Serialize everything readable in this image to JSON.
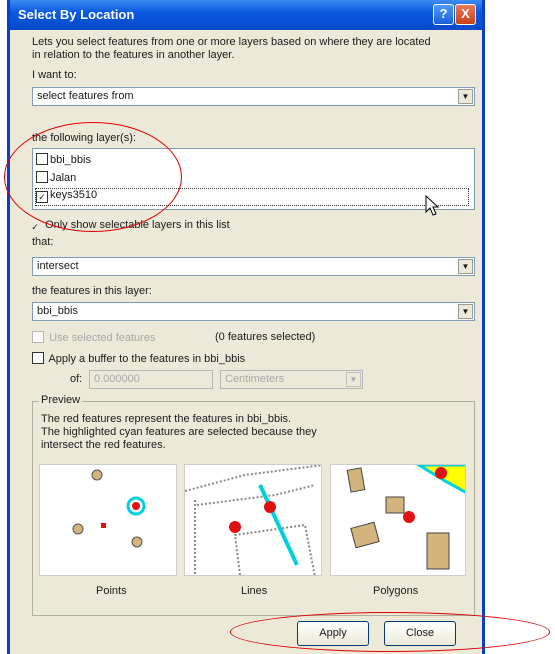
{
  "window": {
    "title": "Select By Location",
    "help_glyph": "?",
    "close_glyph": "X"
  },
  "description": {
    "line1": "Lets you select features from one or more layers based on where they are located",
    "line2": "in relation to the features in another layer."
  },
  "i_want_to": {
    "label": "I want to:",
    "value": "select features from"
  },
  "layers": {
    "label": "the following layer(s):",
    "items": [
      {
        "name": "bbi_bbis",
        "checked": false
      },
      {
        "name": "Jalan",
        "checked": false
      },
      {
        "name": "keys3510",
        "checked": true
      }
    ]
  },
  "only_selectable": {
    "label": "Only show selectable layers in this list",
    "checked": true
  },
  "that": {
    "label": "that:",
    "value": "intersect"
  },
  "features_layer": {
    "label": "the features in this layer:",
    "value": "bbi_bbis"
  },
  "use_selected": {
    "label": "Use selected features",
    "count_text": "(0 features selected)"
  },
  "buffer": {
    "label": "Apply a buffer to the features in  bbi_bbis",
    "of_label": "of:",
    "distance": "0.000000",
    "units": "Centimeters"
  },
  "preview": {
    "title": "Preview",
    "line1": "The red features represent the features in bbi_bbis.",
    "line2": "The highlighted cyan features are selected because they",
    "line3": "intersect the red features.",
    "captions": {
      "points": "Points",
      "lines": "Lines",
      "polygons": "Polygons"
    }
  },
  "buttons": {
    "apply": "Apply",
    "close": "Close"
  },
  "colors": {
    "title_blue": "#0b5ae0",
    "annotation_red": "#e00000",
    "feature_red": "#e01010",
    "selected_cyan": "#00d0e0",
    "polygon_tan": "#d2b47c",
    "highlight_yellow": "#ffff00"
  }
}
